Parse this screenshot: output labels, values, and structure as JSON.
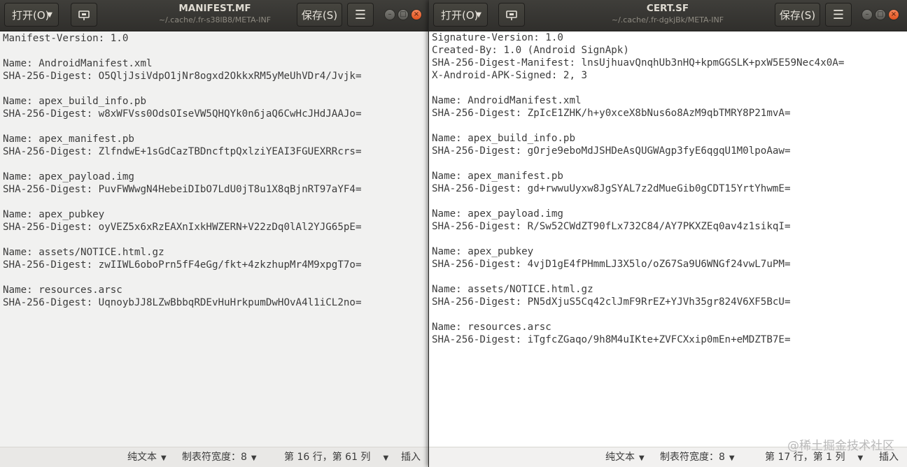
{
  "left_window": {
    "open_label": "打开(O)",
    "save_label": "保存(S)",
    "title": "MANIFEST.MF",
    "subtitle": "~/.cache/.fr-s38lB8/META-INF",
    "lines": [
      "Manifest-Version: 1.0",
      "",
      "Name: AndroidManifest.xml",
      "SHA-256-Digest: O5QljJsiVdpO1jNr8ogxd2OkkxRM5yMeUhVDr4/Jvjk=",
      "",
      "Name: apex_build_info.pb",
      "SHA-256-Digest: w8xWFVss0OdsOIseVW5QHQYk0n6jaQ6CwHcJHdJAAJo=",
      "",
      "Name: apex_manifest.pb",
      "SHA-256-Digest: ZlfndwE+1sGdCazTBDncftpQxlziYEAI3FGUEXRRcrs=",
      "",
      "Name: apex_payload.img",
      "SHA-256-Digest: PuvFWWwgN4HebeiDIbO7LdU0jT8u1X8qBjnRT97aYF4=",
      "",
      "Name: apex_pubkey",
      "SHA-256-Digest: oyVEZ5x6xRzEAXnIxkHWZERN+V22zDq0lAl2YJG65pE=",
      "",
      "Name: assets/NOTICE.html.gz",
      "SHA-256-Digest: zwIIWL6oboPrn5fF4eGg/fkt+4zkzhupMr4M9xpgT7o=",
      "",
      "Name: resources.arsc",
      "SHA-256-Digest: UqnoybJJ8LZwBbbqRDEvHuHrkpumDwHOvA4l1iCL2no="
    ],
    "status": {
      "language": "纯文本",
      "tab_width": "制表符宽度：8",
      "position": "第 16 行，第 61 列",
      "mode": "插入"
    }
  },
  "right_window": {
    "open_label": "打开(O)",
    "save_label": "保存(S)",
    "title": "CERT.SF",
    "subtitle": "~/.cache/.fr-dgkjBk/META-INF",
    "lines": [
      "Signature-Version: 1.0",
      "Created-By: 1.0 (Android SignApk)",
      "SHA-256-Digest-Manifest: lnsUjhuavQnqhUb3nHQ+kpmGGSLK+pxW5E59Nec4x0A=",
      "X-Android-APK-Signed: 2, 3",
      "",
      "Name: AndroidManifest.xml",
      "SHA-256-Digest: ZpIcE1ZHK/h+y0xceX8bNus6o8AzM9qbTMRY8P21mvA=",
      "",
      "Name: apex_build_info.pb",
      "SHA-256-Digest: gOrje9eboMdJSHDeAsQUGWAgp3fyE6qgqU1M0lpoAaw=",
      "",
      "Name: apex_manifest.pb",
      "SHA-256-Digest: gd+rwwuUyxw8JgSYAL7z2dMueGib0gCDT15YrtYhwmE=",
      "",
      "Name: apex_payload.img",
      "SHA-256-Digest: R/Sw52CWdZT90fLx732C84/AY7PKXZEq0av4z1sikqI=",
      "",
      "Name: apex_pubkey",
      "SHA-256-Digest: 4vjD1gE4fPHmmLJ3X5lo/oZ67Sa9U6WNGf24vwL7uPM=",
      "",
      "Name: assets/NOTICE.html.gz",
      "SHA-256-Digest: PN5dXjuS5Cq42clJmF9RrEZ+YJVh35gr824V6XF5BcU=",
      "",
      "Name: resources.arsc",
      "SHA-256-Digest: iTgfcZGaqo/9h8M4uIKte+ZVFCXxip0mEn+eMDZTB7E="
    ],
    "status": {
      "language": "纯文本",
      "tab_width": "制表符宽度：8",
      "position": "第 17 行，第 1 列",
      "mode": "插入"
    }
  },
  "watermark": "@稀土掘金技术社区",
  "icons": {
    "pin": "pin-icon",
    "menu": "hamburger-menu-icon",
    "menu_glyph": "☰",
    "minimize": "minimize-icon",
    "maximize": "maximize-icon",
    "close": "close-icon"
  },
  "colors": {
    "headerbar": "#3c3b37",
    "close_button": "#e95420",
    "editor_bg": "#ffffff",
    "text": "#3c3c3c"
  }
}
